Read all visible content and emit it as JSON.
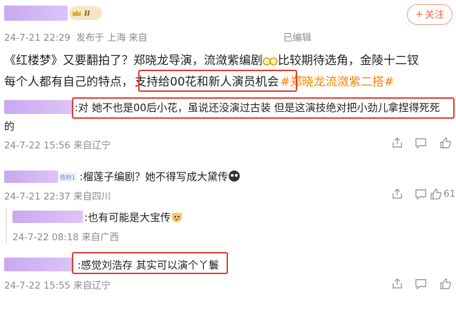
{
  "follow_button": {
    "plus": "+",
    "label": "关注"
  },
  "post": {
    "badge_level": "II",
    "meta_time": "24-7-21 22:29",
    "meta_source": "发布于 上海 来自",
    "edited": "已编辑",
    "line1_a": "《红楼梦》又要翻拍了？郑晓龙导演，流潋紫编剧",
    "line1_b": "比较期待选角，金陵十二钗",
    "line2_a": "每个人都有自己的特点，",
    "line2_box": "支持给00花和新人演员机会",
    "hashtag": "#郑晓龙流潋紫二搭#"
  },
  "comments": [
    {
      "text_line1": ":对 她不也是00后小花，虽说还没演过古装 但是这演技绝对把小劲儿拿捏得死死",
      "text_line2": "的",
      "meta": "24-7-22 15:56 来自辽宁"
    },
    {
      "fan_tag": "铁粉1",
      "text": ":榴莲子编剧？她不得写成大黛传",
      "meta": "24-7-21 22:37 来自四川",
      "like_count": "61"
    },
    {
      "text": ":也有可能是大宝传",
      "meta": "24-7-22 08:18 来自广西"
    },
    {
      "text": ":感觉刘浩存 其实可以演个丫鬟",
      "meta": "24-7-22 15:55 来自辽宁"
    }
  ],
  "icons": [
    "share-icon",
    "comment-icon",
    "like-icon"
  ],
  "colors": {
    "accent": "#ff8200",
    "highlight_box": "#e03b2e",
    "follow": "#f06a3c"
  }
}
